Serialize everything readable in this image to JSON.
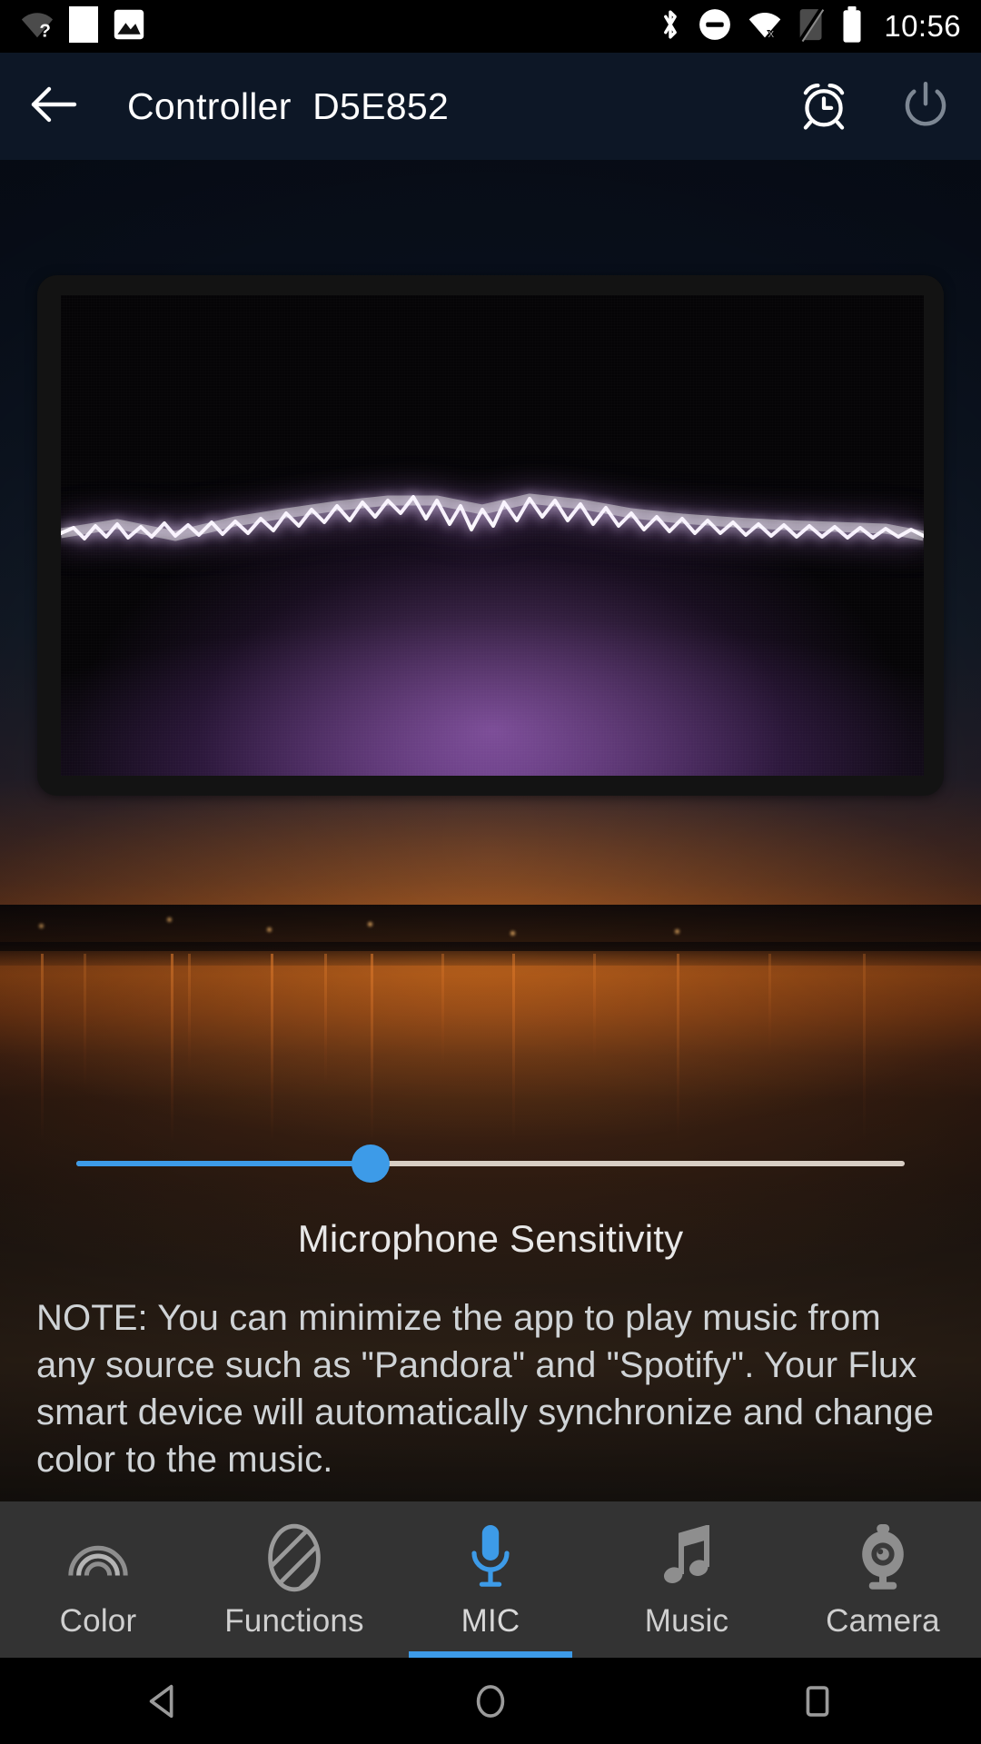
{
  "status_bar": {
    "time": "10:56",
    "left_icons": [
      "wifi-question-icon",
      "white-block-icon",
      "photo-icon"
    ],
    "right_icons": [
      "bluetooth-icon",
      "do-not-disturb-icon",
      "wifi-off-icon",
      "signal-off-icon",
      "battery-icon"
    ]
  },
  "app_bar": {
    "back_icon": "back-arrow-icon",
    "title": "Controller  D5E852",
    "alarm_icon": "alarm-clock-icon",
    "power_icon": "power-icon",
    "background_color": "#0d1726"
  },
  "visualizer": {
    "name": "audio-waveform-visualizer",
    "glow_color": "#af6ed2",
    "wave_color": "#ffffff",
    "background_color": "#050406"
  },
  "slider": {
    "name": "microphone-sensitivity-slider",
    "label": "Microphone Sensitivity",
    "value_percent": 35.5,
    "fill_color": "#3d9be8",
    "track_color": "#d8cec4"
  },
  "note": {
    "text": "NOTE: You can minimize the app to play music from any source such as \"Pandora\" and \"Spotify\". Your Flux smart device will automatically synchronize and change color to the music."
  },
  "tab_bar": {
    "active_color": "#3d9be8",
    "background_color": "#333333",
    "tabs": [
      {
        "label": "Color",
        "icon": "rainbow-arcs-icon",
        "active": false
      },
      {
        "label": "Functions",
        "icon": "striped-oval-icon",
        "active": false
      },
      {
        "label": "MIC",
        "icon": "microphone-icon",
        "active": true
      },
      {
        "label": "Music",
        "icon": "music-note-icon",
        "active": false
      },
      {
        "label": "Camera",
        "icon": "webcam-icon",
        "active": false
      }
    ]
  },
  "nav_bar": {
    "back": "nav-back-icon",
    "home": "nav-home-icon",
    "recents": "nav-recents-icon"
  }
}
